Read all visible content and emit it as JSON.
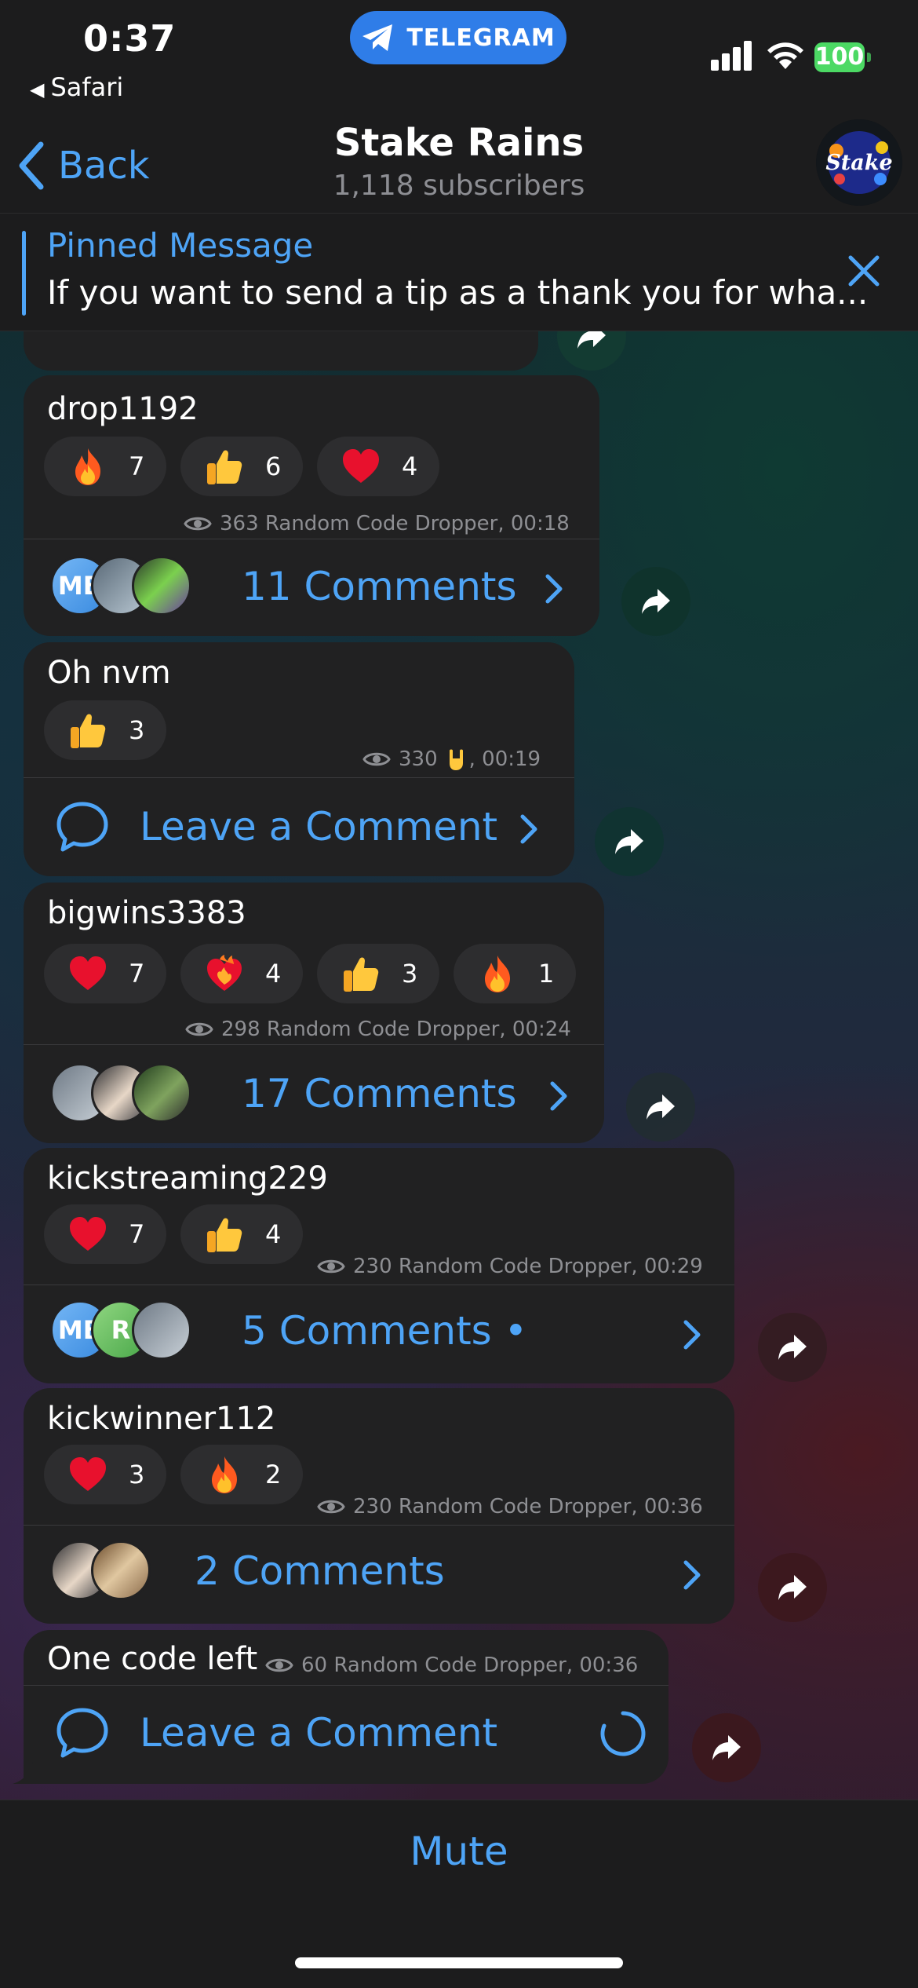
{
  "status_bar": {
    "time": "0:37",
    "back_app": "Safari",
    "pill_label": "TELEGRAM",
    "battery": "100"
  },
  "nav": {
    "back_label": "Back",
    "title": "Stake Rains",
    "subtitle": "1,118 subscribers",
    "avatar_text": "Stake"
  },
  "pinned": {
    "title": "Pinned Message",
    "text": "If you want to send a tip as a thank you for wha..."
  },
  "messages": [
    {
      "sender": "drop1192",
      "reactions": [
        {
          "emoji": "fire",
          "count": "7"
        },
        {
          "emoji": "thumbs-up",
          "count": "6"
        },
        {
          "emoji": "heart",
          "count": "4"
        }
      ],
      "meta": "363 Random Code Dropper, 00:18",
      "comments": "11 Comments"
    },
    {
      "sender": "Oh nvm",
      "reactions": [
        {
          "emoji": "thumbs-up",
          "count": "3"
        }
      ],
      "meta_views": "330",
      "meta_time": ", 00:19",
      "comments": "Leave a Comment"
    },
    {
      "sender": "bigwins3383",
      "reactions": [
        {
          "emoji": "heart",
          "count": "7"
        },
        {
          "emoji": "heart-on-fire",
          "count": "4"
        },
        {
          "emoji": "thumbs-up",
          "count": "3"
        },
        {
          "emoji": "fire",
          "count": "1"
        }
      ],
      "meta": "298 Random Code Dropper, 00:24",
      "comments": "17 Comments"
    },
    {
      "sender": "kickstreaming229",
      "reactions": [
        {
          "emoji": "heart",
          "count": "7"
        },
        {
          "emoji": "thumbs-up",
          "count": "4"
        }
      ],
      "meta": "230 Random Code Dropper, 00:29",
      "comments": "5 Comments •"
    },
    {
      "sender": "kickwinner112",
      "reactions": [
        {
          "emoji": "heart",
          "count": "3"
        },
        {
          "emoji": "fire",
          "count": "2"
        }
      ],
      "meta": "230 Random Code Dropper, 00:36",
      "comments": "2 Comments"
    },
    {
      "sender": "One code left",
      "reactions": [],
      "meta": "60 Random Code Dropper, 00:36",
      "comments": "Leave a Comment"
    }
  ],
  "avatars": {
    "mb": "MB",
    "r": "R"
  },
  "bottom": {
    "mute_label": "Mute"
  },
  "colors": {
    "accent": "#4ea4f6",
    "bubble": "#212122",
    "reaction": "#2d2d2f",
    "battery": "#4cd964"
  }
}
